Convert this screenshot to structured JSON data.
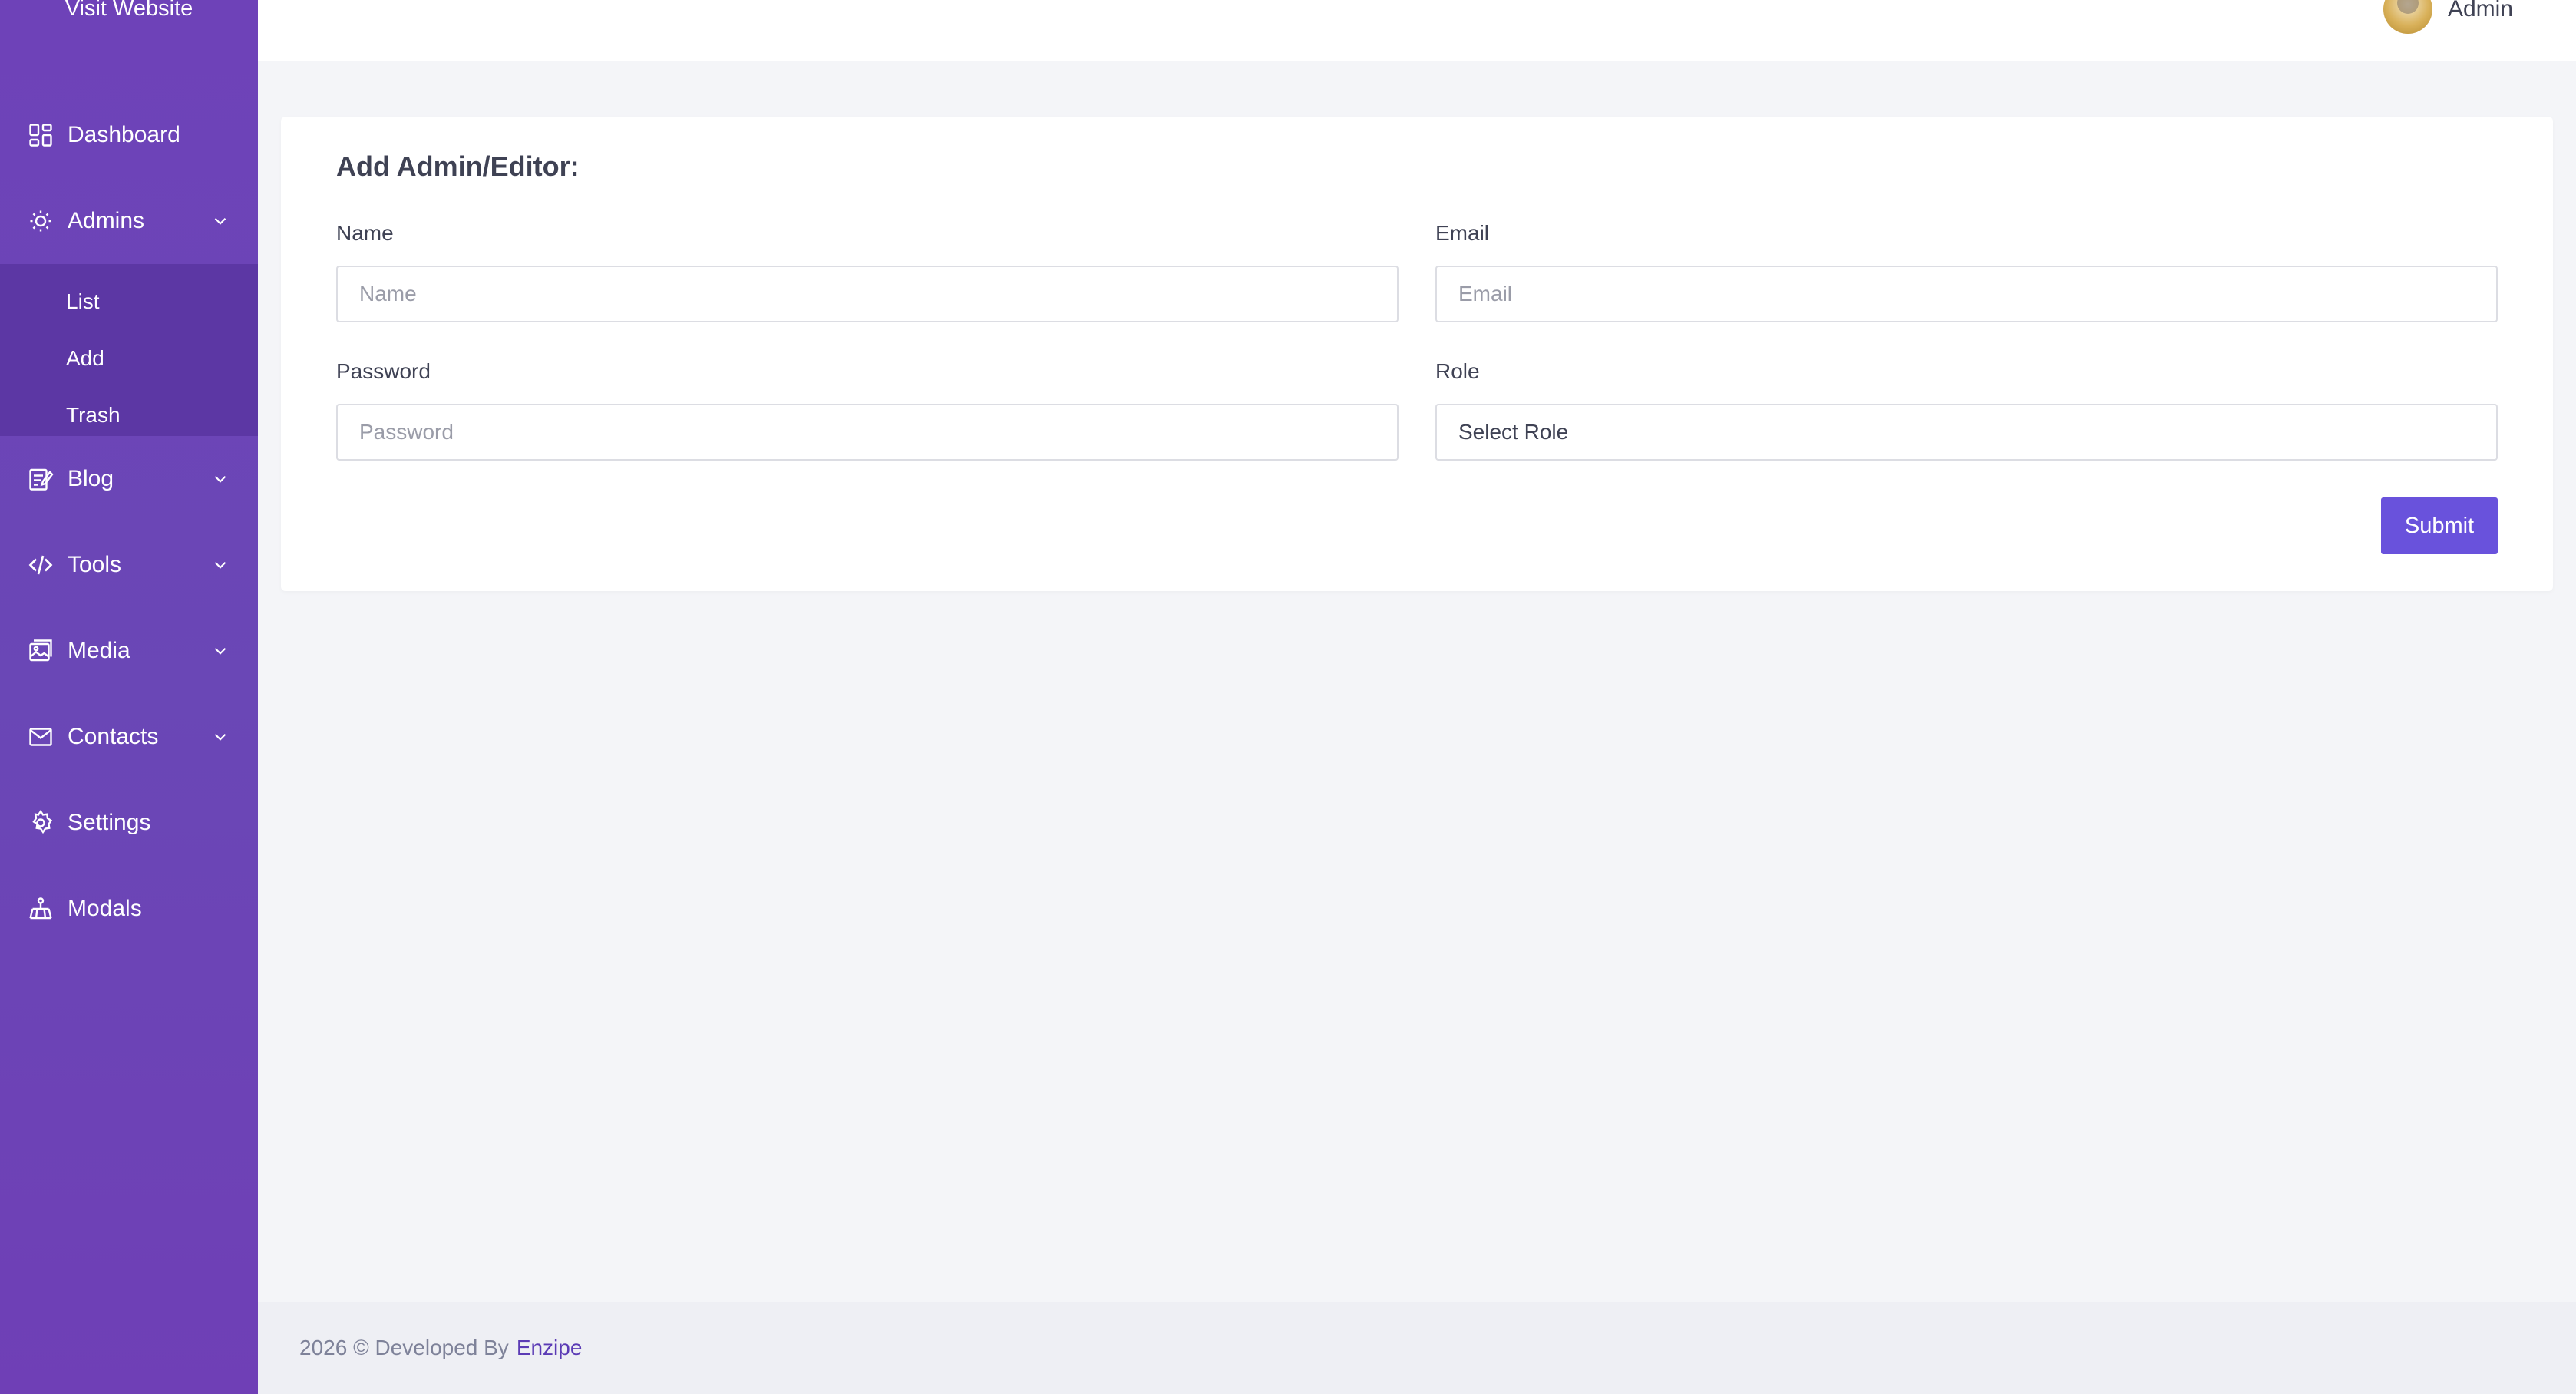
{
  "sidebar": {
    "visit_website": "Visit Website",
    "items": [
      {
        "label": "Dashboard",
        "icon": "dashboard-icon"
      },
      {
        "label": "Admins",
        "icon": "admins-icon",
        "expanded": true,
        "children": [
          "List",
          "Add",
          "Trash"
        ]
      },
      {
        "label": "Blog",
        "icon": "blog-icon"
      },
      {
        "label": "Tools",
        "icon": "code-icon"
      },
      {
        "label": "Media",
        "icon": "media-icon"
      },
      {
        "label": "Contacts",
        "icon": "mail-icon"
      },
      {
        "label": "Settings",
        "icon": "gear-icon"
      },
      {
        "label": "Modals",
        "icon": "modals-icon"
      }
    ]
  },
  "topbar": {
    "user_name": "Admin"
  },
  "form": {
    "title": "Add Admin/Editor:",
    "name_label": "Name",
    "name_placeholder": "Name",
    "email_label": "Email",
    "email_placeholder": "Email",
    "password_label": "Password",
    "password_placeholder": "Password",
    "role_label": "Role",
    "role_selected": "Select Role",
    "submit_label": "Submit"
  },
  "footer": {
    "text": "2026 © Developed By",
    "brand": "Enzipe"
  },
  "colors": {
    "sidebar": "#6a45b7",
    "submenu": "#5c37a4",
    "accent": "#6952dc",
    "page_bg": "#f4f5f8"
  }
}
